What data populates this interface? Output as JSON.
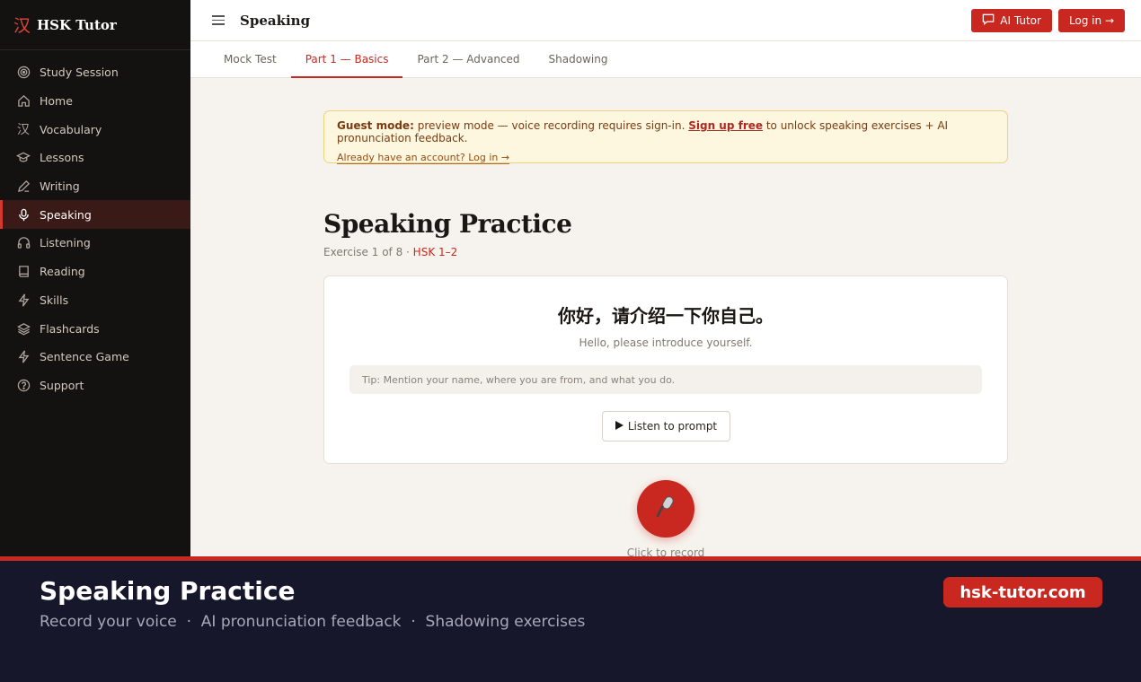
{
  "brand": {
    "mark": "汉",
    "name": "HSK Tutor"
  },
  "sidebar": {
    "items": [
      {
        "label": "Study Session",
        "icon": "target-icon"
      },
      {
        "label": "Home",
        "icon": "home-icon"
      },
      {
        "label": "Vocabulary",
        "icon": "hanzi-icon"
      },
      {
        "label": "Lessons",
        "icon": "graduation-cap-icon"
      },
      {
        "label": "Writing",
        "icon": "pen-icon"
      },
      {
        "label": "Speaking",
        "icon": "microphone-icon",
        "active": true
      },
      {
        "label": "Listening",
        "icon": "headphones-icon"
      },
      {
        "label": "Reading",
        "icon": "book-icon"
      },
      {
        "label": "Skills",
        "icon": "bolt-icon"
      },
      {
        "label": "Flashcards",
        "icon": "layers-icon"
      },
      {
        "label": "Sentence Game",
        "icon": "bolt-icon"
      },
      {
        "label": "Support",
        "icon": "help-circle-icon"
      }
    ]
  },
  "header": {
    "title": "Speaking",
    "ai_tutor_label": "AI Tutor",
    "login_label": "Log in →"
  },
  "tabs": [
    {
      "label": "Mock Test"
    },
    {
      "label": "Part 1 — Basics",
      "active": true
    },
    {
      "label": "Part 2 — Advanced"
    },
    {
      "label": "Shadowing"
    }
  ],
  "guest_notice": {
    "label": "Guest mode:",
    "text": "preview mode — voice recording requires sign-in.",
    "signup_link": "Sign up free",
    "text_after": "to unlock speaking exercises + AI pronunciation feedback.",
    "login_link": "Already have an account? Log in →"
  },
  "practice": {
    "title": "Speaking Practice",
    "exercise_progress": "Exercise 1 of 8 ·",
    "level": "HSK 1–2",
    "prompt_zh": "你好，请介绍一下你自己。",
    "prompt_en": "Hello, please introduce yourself.",
    "tip": "Tip: Mention your name, where you are from, and what you do.",
    "listen_label": "Listen to prompt",
    "record_caption": "Click to record"
  },
  "banner": {
    "title": "Speaking Practice",
    "subtitle": "Record your voice  ·  AI pronunciation feedback  ·  Shadowing exercises",
    "url": "hsk-tutor.com"
  },
  "colors": {
    "accent": "#c8281f",
    "sidebar_bg": "#141211",
    "page_bg": "#f6f3ee",
    "banner_bg": "#16172a"
  }
}
